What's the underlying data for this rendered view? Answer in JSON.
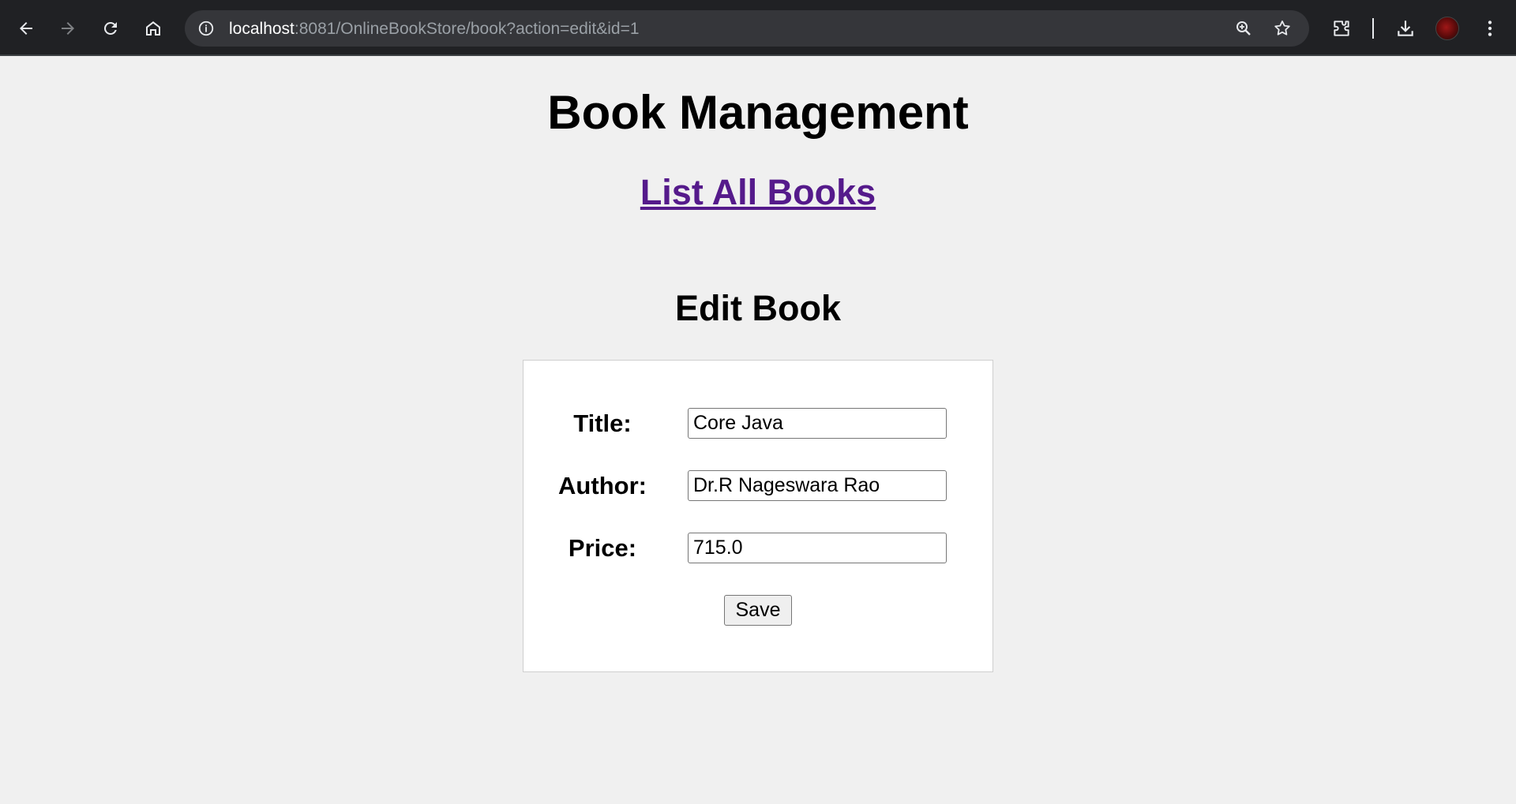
{
  "browser": {
    "url_host": "localhost",
    "url_rest": ":8081/OnlineBookStore/book?action=edit&id=1",
    "icons": [
      "back-arrow-icon",
      "forward-arrow-icon",
      "reload-icon",
      "home-icon",
      "site-info-icon",
      "zoom-icon",
      "bookmark-star-icon",
      "extensions-icon",
      "download-icon",
      "profile-avatar",
      "menu-dots-icon"
    ]
  },
  "page": {
    "title": "Book Management",
    "list_link": "List All Books",
    "form_title": "Edit Book",
    "link_color": "#551a8b"
  },
  "form": {
    "title_label": "Title:",
    "title_value": "Core Java",
    "author_label": "Author:",
    "author_value": "Dr.R Nageswara Rao",
    "price_label": "Price:",
    "price_value": "715.0",
    "save_label": "Save"
  }
}
